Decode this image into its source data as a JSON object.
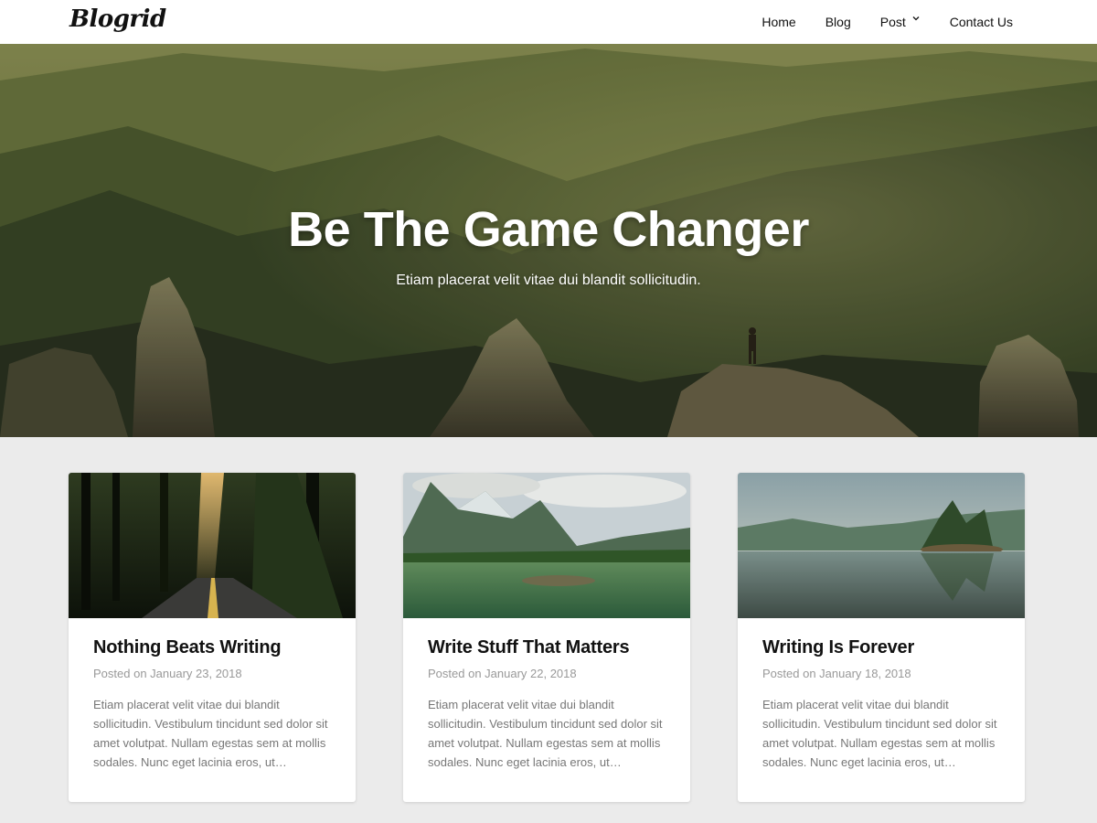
{
  "header": {
    "logo": "Blogrid",
    "nav": [
      {
        "label": "Home"
      },
      {
        "label": "Blog"
      },
      {
        "label": "Post"
      },
      {
        "label": "Contact Us"
      }
    ]
  },
  "hero": {
    "title": "Be The Game Changer",
    "subtitle": "Etiam placerat velit vitae dui blandit sollicitudin."
  },
  "posts": [
    {
      "title": "Nothing Beats Writing",
      "date": "Posted on January 23, 2018",
      "excerpt": "Etiam placerat velit vitae dui blandit sollicitudin. Vestibulum tincidunt sed dolor sit amet volutpat. Nullam egestas sem at mollis sodales. Nunc eget lacinia eros, ut…"
    },
    {
      "title": "Write Stuff That Matters",
      "date": "Posted on January 22, 2018",
      "excerpt": "Etiam placerat velit vitae dui blandit sollicitudin. Vestibulum tincidunt sed dolor sit amet volutpat. Nullam egestas sem at mollis sodales. Nunc eget lacinia eros, ut…"
    },
    {
      "title": "Writing Is Forever",
      "date": "Posted on January 18, 2018",
      "excerpt": "Etiam placerat velit vitae dui blandit sollicitudin. Vestibulum tincidunt sed dolor sit amet volutpat. Nullam egestas sem at mollis sodales. Nunc eget lacinia eros, ut…"
    }
  ]
}
